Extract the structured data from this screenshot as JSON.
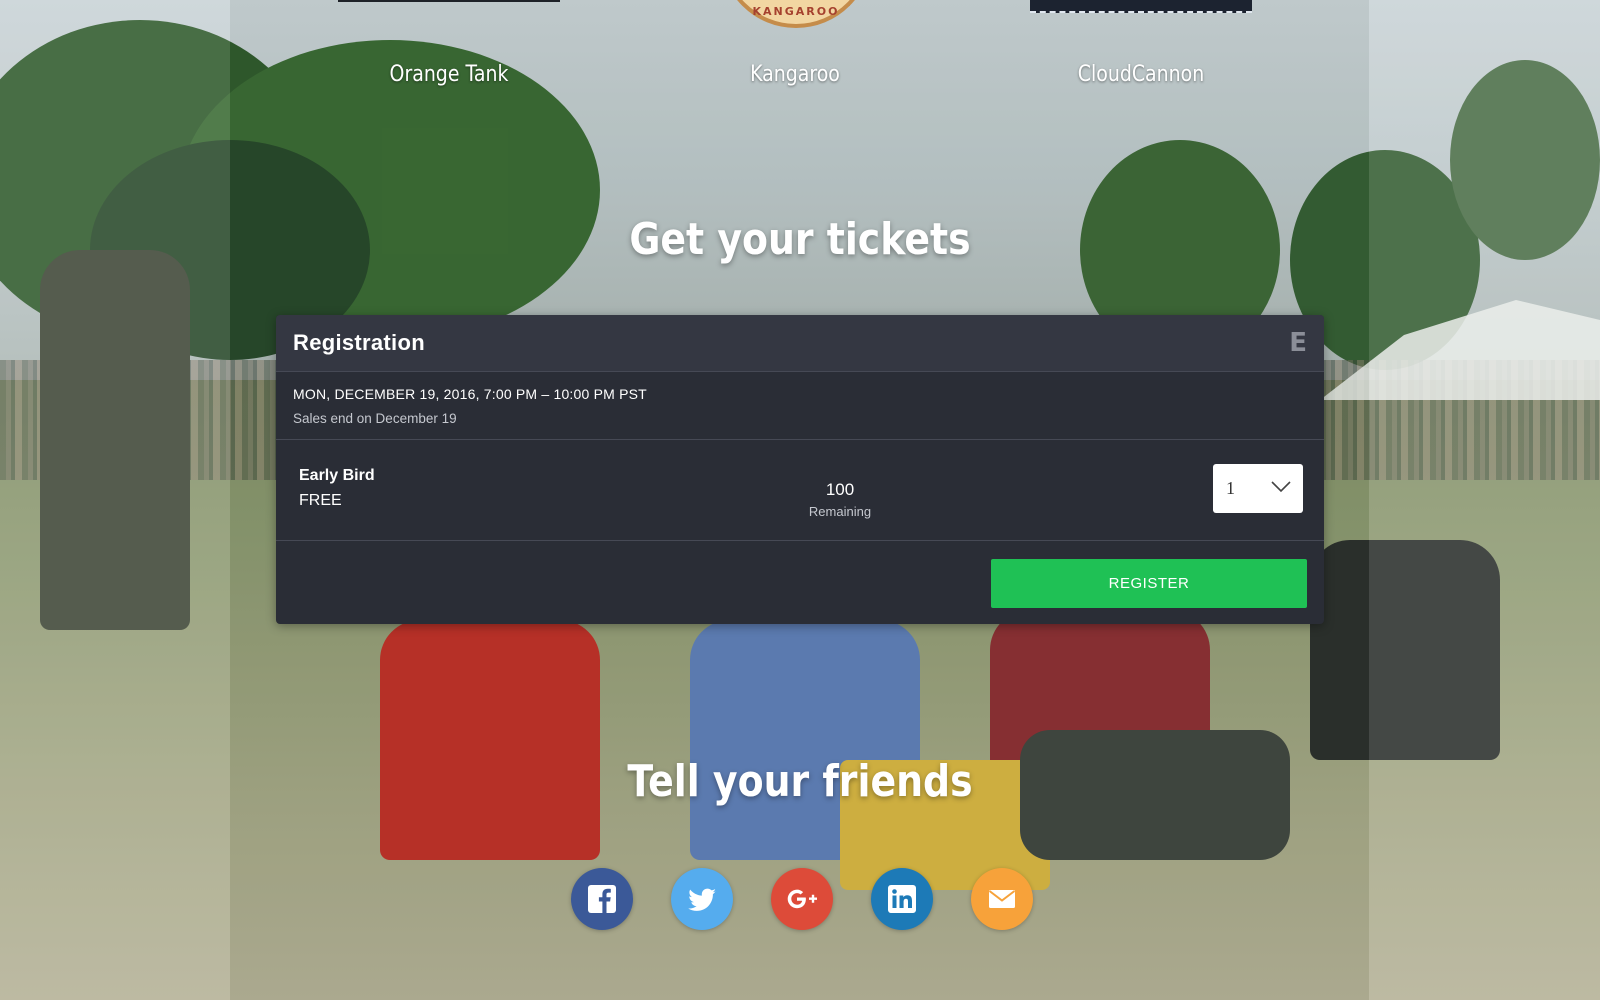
{
  "sponsors": [
    {
      "name": "Orange Tank"
    },
    {
      "name": "Kangaroo",
      "logo_text": "KANGAROO"
    },
    {
      "name": "CloudCannon"
    }
  ],
  "tickets_section": {
    "title": "Get your tickets"
  },
  "registration": {
    "title": "Registration",
    "brand_icon": "eventbrite-e-icon",
    "brand_glyph": "E",
    "event_date": "MON, DECEMBER 19, 2016, 7:00 PM – 10:00 PM PST",
    "sales_end": "Sales end on December 19",
    "ticket": {
      "name": "Early Bird",
      "price": "FREE",
      "remaining_count": "100",
      "remaining_label": "Remaining",
      "quantity": "1"
    },
    "register_label": "REGISTER",
    "register_color": "#1fc155"
  },
  "friends_section": {
    "title": "Tell your friends"
  },
  "social": [
    {
      "name": "facebook",
      "icon": "facebook-icon",
      "color": "#3b5998"
    },
    {
      "name": "twitter",
      "icon": "twitter-icon",
      "color": "#55acee"
    },
    {
      "name": "google-plus",
      "icon": "google-plus-icon",
      "color": "#dd4b39"
    },
    {
      "name": "linkedin",
      "icon": "linkedin-icon",
      "color": "#1d7ab7"
    },
    {
      "name": "email",
      "icon": "email-icon",
      "color": "#f7a23a"
    }
  ]
}
